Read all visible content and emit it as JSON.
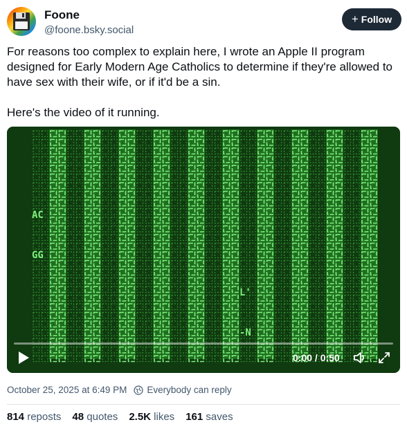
{
  "author": {
    "display_name": "Foone",
    "handle": "@foone.bsky.social",
    "avatar_icon": "rainbow-floppy-disk-avatar"
  },
  "follow_button": {
    "label": "Follow",
    "icon": "plus-icon"
  },
  "post": {
    "text": "For reasons too complex to explain here, I wrote an Apple II program designed for Early Modern Age Catholics to determine if they're allowed to have sex with their wife, or if it'd be a sin.\n\nHere's the video of it running."
  },
  "video": {
    "time": "0:00 / 0:50",
    "progress": 0,
    "screen_colors": {
      "bg": "#103a10",
      "bright": "#7ef07e",
      "dim": "#2f8f2f"
    },
    "screen_text": {
      "row_a": "AC",
      "row_g": "GG",
      "row_l": "L'",
      "row_n": "-N"
    }
  },
  "meta": {
    "timestamp": "October 25, 2025 at 6:49 PM",
    "reply_setting": "Everybody can reply"
  },
  "stats": {
    "reposts_count": "814",
    "reposts_label": "reposts",
    "quotes_count": "48",
    "quotes_label": "quotes",
    "likes_count": "2.5K",
    "likes_label": "likes",
    "saves_count": "161",
    "saves_label": "saves"
  }
}
